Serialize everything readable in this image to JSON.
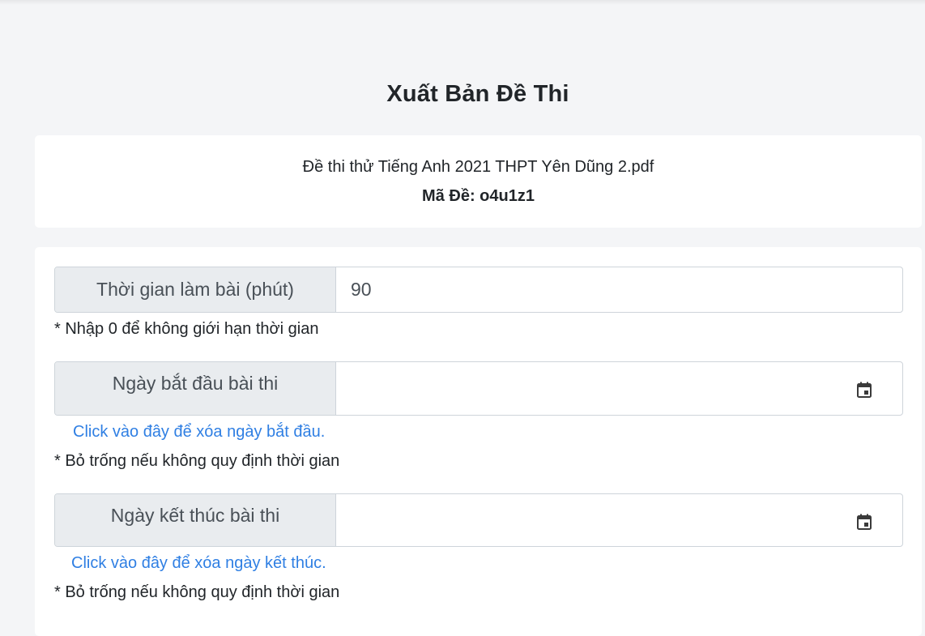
{
  "page": {
    "title": "Xuất Bản Đề Thi"
  },
  "exam_info": {
    "file_name": "Đề thi thử Tiếng Anh 2021 THPT Yên Dũng 2.pdf",
    "code_text": "Mã Đề: o4u1z1"
  },
  "form": {
    "duration": {
      "label": "Thời gian làm bài (phút)",
      "value": "90",
      "note": "* Nhập 0 để không giới hạn thời gian"
    },
    "start_date": {
      "label": "Ngày bắt đầu bài thi",
      "value": "",
      "icon": "calendar-icon",
      "clear_link": "Click vào đây để xóa ngày bắt đầu.",
      "note": "* Bỏ trống nếu không quy định thời gian"
    },
    "end_date": {
      "label": "Ngày kết thúc bài thi",
      "value": "",
      "icon": "calendar-icon",
      "clear_link": "Click vào đây để xóa ngày kết thúc.",
      "note": "* Bỏ trống nếu không quy định thời gian"
    }
  },
  "colors": {
    "link": "#2f7fe3",
    "addon_bg": "#e9ecef",
    "page_bg": "#f4f5f7"
  }
}
